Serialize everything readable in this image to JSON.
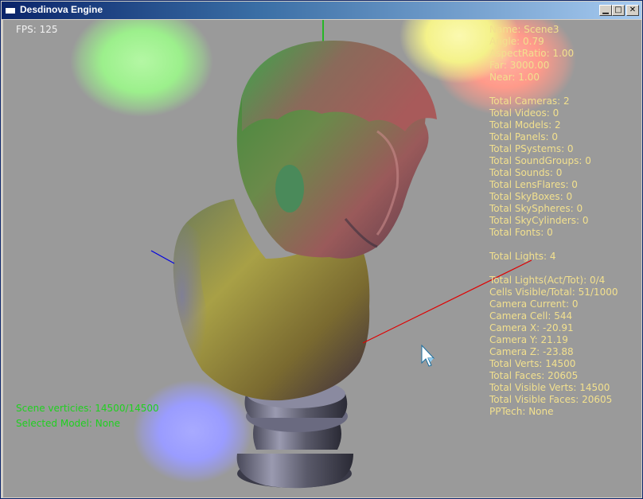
{
  "window": {
    "title": "Desdinova Engine",
    "minimize_glyph": "0",
    "maximize_glyph": "1",
    "close_glyph": "r"
  },
  "hud": {
    "fps": "FPS: 125",
    "info_lines": [
      "Name: Scene3",
      "Angle: 0.79",
      "AspectRatio: 1.00",
      "Far: 3000.00",
      "Near: 1.00",
      "",
      "Total Cameras: 2",
      "Total Videos: 0",
      "Total Models: 2",
      "Total Panels: 0",
      "Total PSystems: 0",
      "Total SoundGroups: 0",
      "Total Sounds: 0",
      "Total LensFlares: 0",
      "Total SkyBoxes: 0",
      "Total SkySpheres: 0",
      "Total SkyCylinders: 0",
      "Total Fonts: 0",
      "",
      "Total Lights: 4",
      "",
      "Total Lights(Act/Tot): 0/4",
      "Cells Visible/Total: 51/1000",
      "Camera Current: 0",
      "Camera Cell: 544",
      "Camera X: -20.91",
      "Camera Y: 21.19",
      "Camera Z: -23.88",
      "Total Verts: 14500",
      "Total Faces: 20605",
      "Total Visible Verts: 14500",
      "Total Visible Faces: 20605",
      "PPTech: None"
    ],
    "scene_vertices": "Scene verticies: 14500/14500",
    "selected_model": "Selected Model: None"
  },
  "colors": {
    "background": "#9a9a9a",
    "hud_text": "#f2e08e",
    "status_text": "#20d020",
    "light_green": "#9cf08c",
    "light_yellow": "#f4f28a",
    "light_red": "#ff9a8a",
    "light_blue": "#9a9cff",
    "axis_x": "#e00000",
    "axis_y": "#00c000",
    "axis_z": "#0000e0"
  }
}
